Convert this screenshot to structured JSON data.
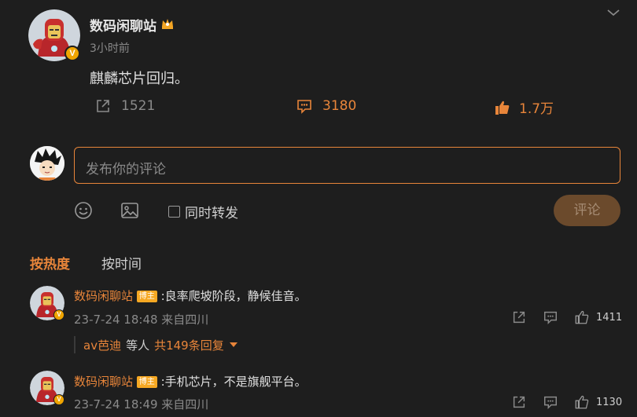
{
  "post": {
    "author": "数码闲聊站",
    "time": "3小时前",
    "text": "麒麟芯片回归。",
    "repost_count": "1521",
    "comment_count": "3180",
    "like_count": "1.7万"
  },
  "compose": {
    "placeholder": "发布你的评论",
    "also_repost_label": "同时转发",
    "submit_label": "评论"
  },
  "sort_tabs": [
    "按热度",
    "按时间"
  ],
  "comments": [
    {
      "author": "数码闲聊站",
      "badge": "博主",
      "text": ":良率爬坡阶段，静候佳音。",
      "time": "23-7-24 18:48 来自四川",
      "likes": "1411",
      "replies": {
        "names": "av芭迪",
        "mid": "等人",
        "count": "共149条回复"
      }
    },
    {
      "author": "数码闲聊站",
      "badge": "博主",
      "text": ":手机芯片，不是旗舰平台。",
      "time": "23-7-24 18:49 来自四川",
      "likes": "1130"
    }
  ],
  "colors": {
    "accent": "#e8853a",
    "background": "#1e1e1e",
    "badge": "#f6a823"
  }
}
